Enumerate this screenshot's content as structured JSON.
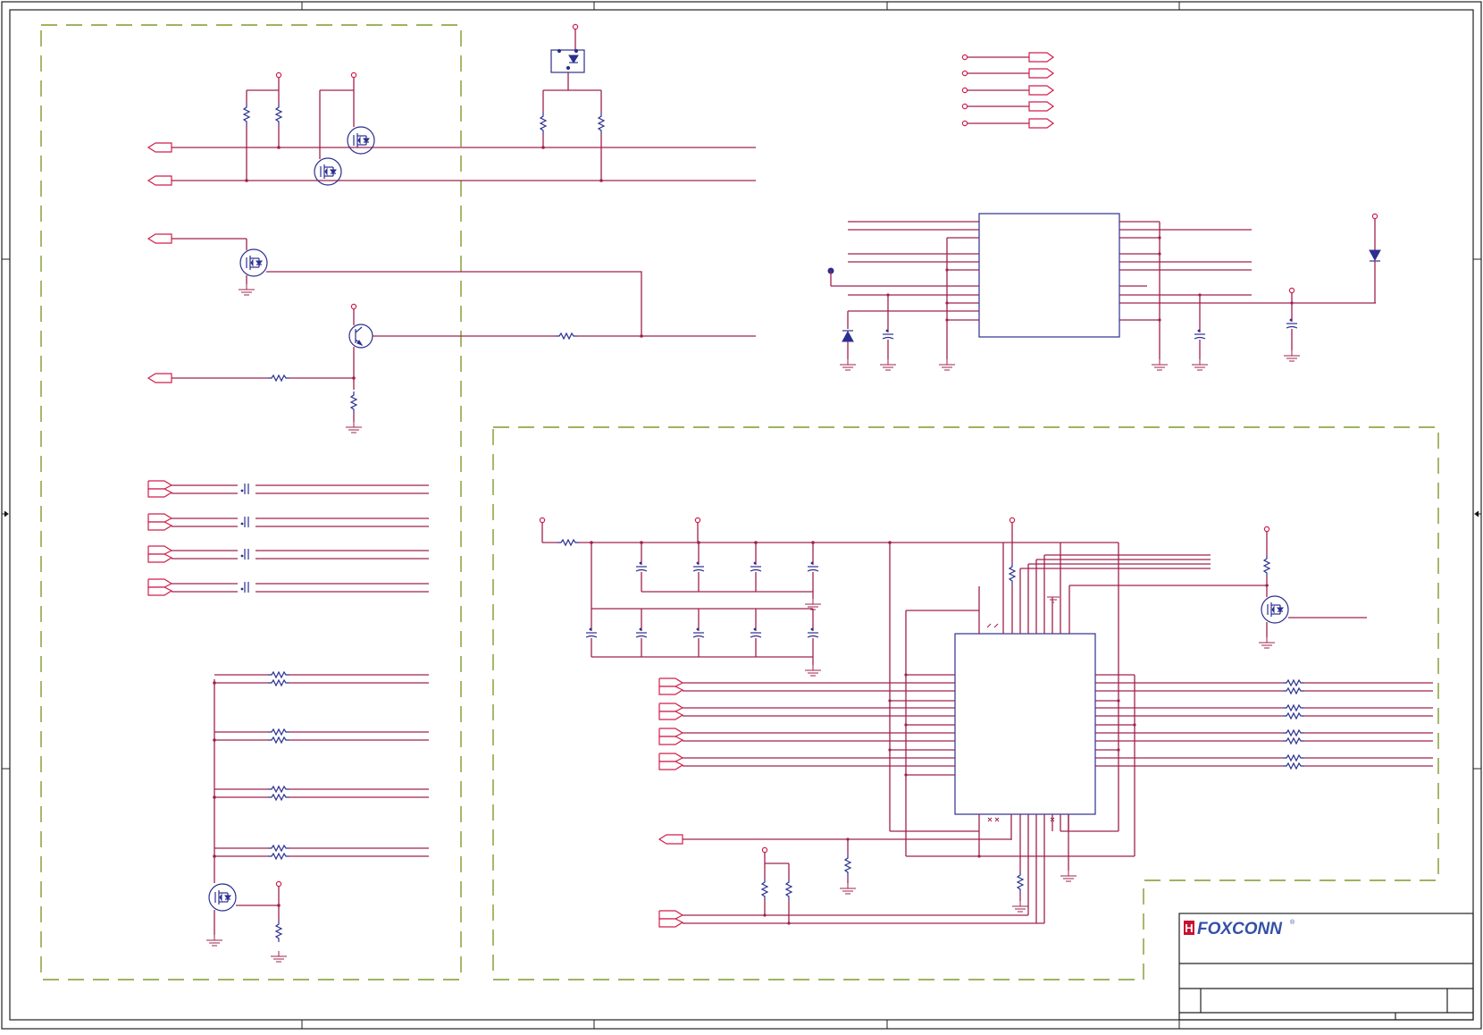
{
  "title_block": {
    "logo_text": "FOXCONN",
    "logo_mark": "H",
    "registered_mark": "®"
  },
  "colors": {
    "wire": "#a0204f",
    "component": "#2b2f8f",
    "power_pin": "#d01e4a",
    "group_box": "#7f9a2c",
    "logo_blue": "#3550a8",
    "logo_red": "#c8102e"
  }
}
